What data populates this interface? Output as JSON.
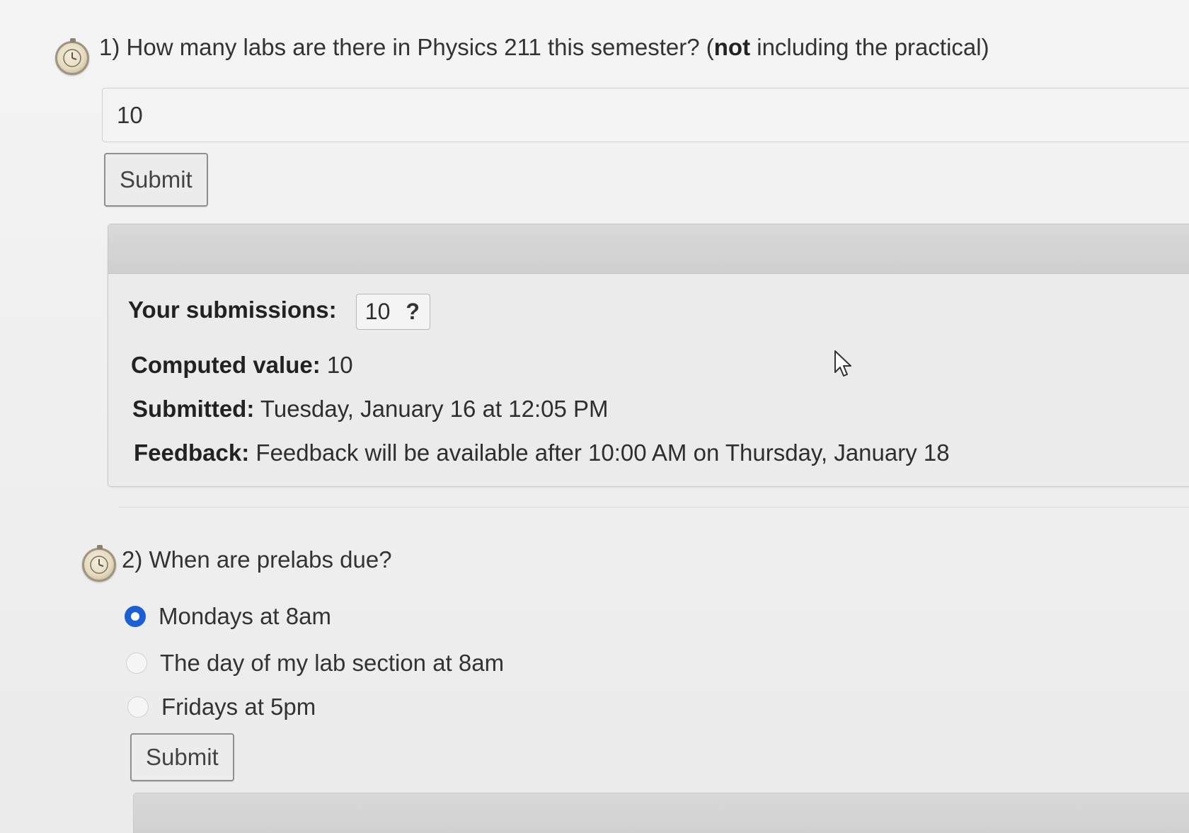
{
  "question1": {
    "prompt_prefix": "1) How many labs are there in Physics 211 this semester? (",
    "prompt_bold": "not",
    "prompt_suffix": " including the practical)",
    "answer_value": "10",
    "submit_label": "Submit",
    "result": {
      "submissions_label": "Your submissions:",
      "submissions_value": "10",
      "submissions_status_icon": "?",
      "computed_label": "Computed value:",
      "computed_value": "10",
      "submitted_label": "Submitted:",
      "submitted_value": "Tuesday, January 16 at 12:05 PM",
      "feedback_label": "Feedback:",
      "feedback_value": "Feedback will be available after 10:00 AM on Thursday, January 18"
    }
  },
  "question2": {
    "prompt": "2) When are prelabs due?",
    "options": [
      {
        "label": "Mondays at 8am",
        "selected": true
      },
      {
        "label": "The day of my lab section at 8am",
        "selected": false
      },
      {
        "label": "Fridays at 5pm",
        "selected": false
      }
    ],
    "submit_label": "Submit"
  },
  "icons": {
    "question_timer": "stopwatch-icon",
    "radio_selected_color": "#1a5fd6"
  }
}
